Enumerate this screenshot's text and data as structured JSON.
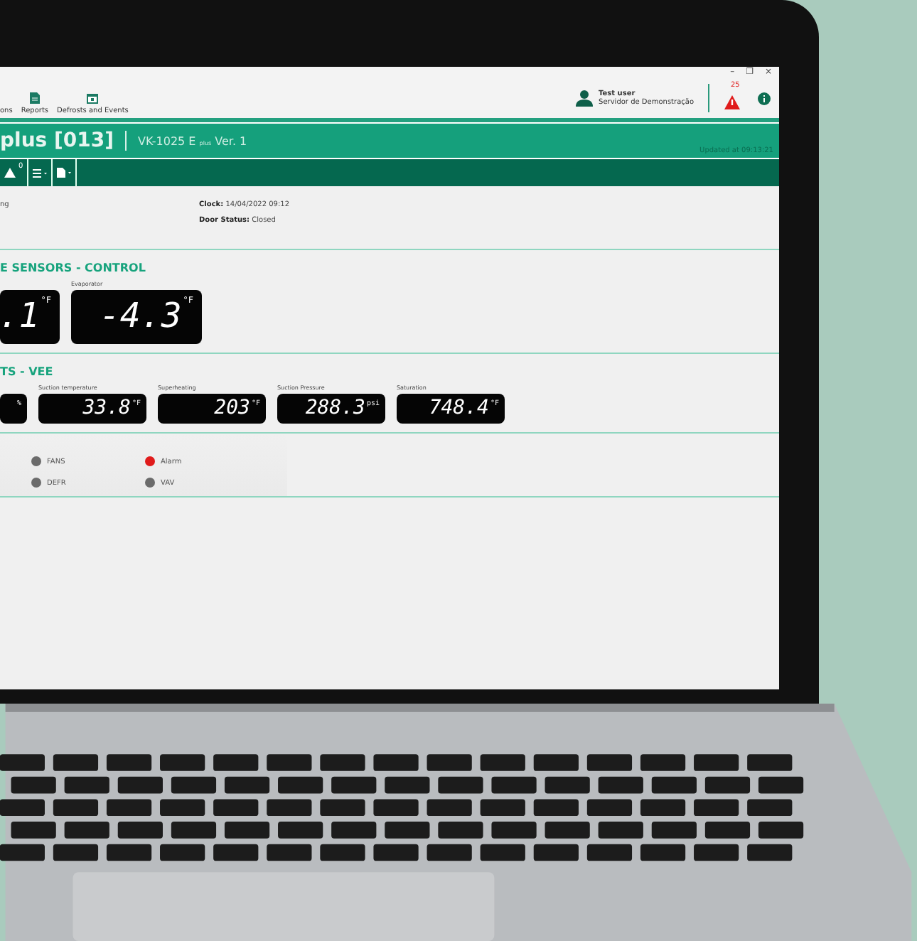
{
  "window": {
    "controls": [
      "–",
      "❐",
      "×"
    ]
  },
  "nav": [
    {
      "label": "ons",
      "kind": "none"
    },
    {
      "label": "Reports",
      "kind": "document"
    },
    {
      "label": "Defrosts and Events",
      "kind": "calendar"
    }
  ],
  "user": {
    "name": "Test user",
    "server": "Servidor de Demonstração",
    "alarm_count": "25"
  },
  "header": {
    "title": "plus [013]",
    "model": "VK-1025 E",
    "model_suffix": "plus",
    "version": "Ver. 1",
    "updated": "Updated at 09:13:21"
  },
  "toolbar": {
    "alarm_count": "0"
  },
  "info": {
    "left": "ng",
    "fields": [
      {
        "label": "Clock:",
        "value": "14/04/2022  09:12"
      },
      {
        "label": "Door Status:",
        "value": "Closed"
      }
    ]
  },
  "sections": [
    {
      "title": "E SENSORS - CONTROL",
      "kind": "large",
      "displays": [
        {
          "value": ".1",
          "unit": "°F"
        },
        {
          "label": "Evaporator",
          "value": "-4.3",
          "unit": "°F"
        }
      ]
    },
    {
      "title": "TS - VEE",
      "kind": "small",
      "displays": [
        {
          "unit": "%"
        },
        {
          "label": "Suction temperature",
          "value": "33.8",
          "unit": "°F"
        },
        {
          "label": "Superheating",
          "value": "203",
          "unit": "°F"
        },
        {
          "label": "Suction Pressure",
          "value": "288.3",
          "unit": "psi"
        },
        {
          "label": "Saturation",
          "value": "748.4",
          "unit": "°F"
        }
      ]
    }
  ],
  "indicators": [
    {
      "label": "FANS",
      "color": "#6b6b6b"
    },
    {
      "label": "Alarm",
      "color": "#e01b1b"
    },
    {
      "label": "DEFR",
      "color": "#6b6b6b"
    },
    {
      "label": "VAV",
      "color": "#6b6b6b"
    }
  ]
}
